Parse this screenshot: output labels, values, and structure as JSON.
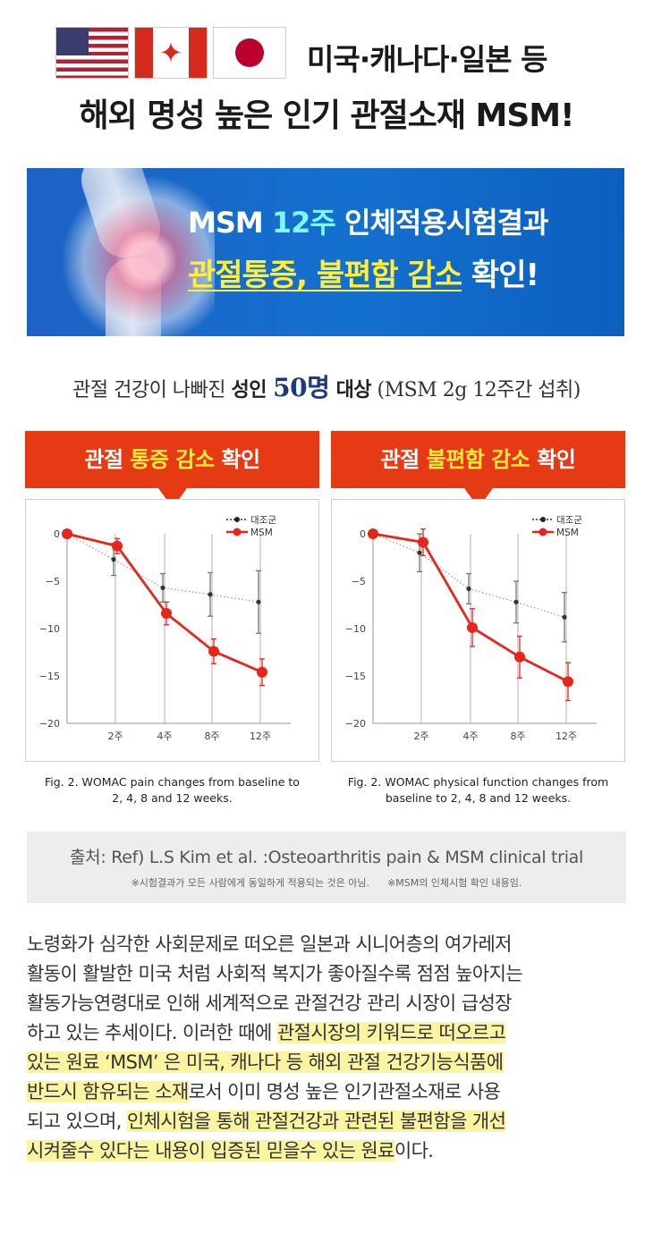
{
  "header": {
    "line1": "미국·캐나다·일본 등",
    "line2": "해외 명성 높은 인기 관절소재 MSM!"
  },
  "banner": {
    "l1_pre": "MSM ",
    "l1_hl": "12주",
    "l1_post": " 인체적용시험결과",
    "l2_hl": "관절통증, 불편함 감소",
    "l2_post": " 확인!"
  },
  "subject": {
    "pre": "관절 건강이 나빠진 ",
    "bold1": "성인 ",
    "num": "50명",
    "bold2": " 대상",
    "post": " (MSM 2g 12주간 섭취)"
  },
  "panels": {
    "left_title_pre": "관절 ",
    "left_title_hl": "통증 감소",
    "left_title_post": " 확인",
    "right_title_pre": "관절 ",
    "right_title_hl": "불편함 감소",
    "right_title_post": " 확인",
    "left_caption_1": "Fig. 2. WOMAC pain changes from baseline to",
    "left_caption_2": "2, 4, 8 and 12 weeks.",
    "right_caption_1": "Fig. 2. WOMAC physical function changes from",
    "right_caption_2": "baseline to 2, 4, 8 and 12 weeks."
  },
  "chart_data": [
    {
      "type": "line",
      "title": "",
      "x": [
        "0",
        "2주",
        "4주",
        "8주",
        "12주"
      ],
      "xticks": [
        "2주",
        "4주",
        "8주",
        "12주"
      ],
      "yticks": [
        "0",
        "−5",
        "−10",
        "−15",
        "−20"
      ],
      "ylim": [
        -20,
        0
      ],
      "grid": "vertical",
      "legend": "top-right",
      "series": [
        {
          "name": "대조군",
          "values": [
            0,
            -2.7,
            -5.7,
            -6.4,
            -7.2
          ],
          "err": [
            0,
            1.7,
            1.5,
            2.3,
            3.3
          ],
          "color": "#333333",
          "style": "dotted"
        },
        {
          "name": "MSM",
          "values": [
            0,
            -1.3,
            -8.4,
            -12.4,
            -14.6
          ],
          "err": [
            0,
            0.8,
            1.2,
            1.3,
            1.4
          ],
          "color": "#e8241b",
          "style": "solid"
        }
      ]
    },
    {
      "type": "line",
      "title": "",
      "x": [
        "0",
        "2주",
        "4주",
        "8주",
        "12주"
      ],
      "xticks": [
        "2주",
        "4주",
        "8주",
        "12주"
      ],
      "yticks": [
        "0",
        "−5",
        "−10",
        "−15",
        "−20"
      ],
      "ylim": [
        -20,
        0
      ],
      "grid": "vertical",
      "legend": "top-right",
      "series": [
        {
          "name": "대조군",
          "values": [
            0,
            -2.0,
            -5.8,
            -7.2,
            -8.8
          ],
          "err": [
            0,
            2.0,
            1.6,
            2.2,
            2.6
          ],
          "color": "#333333",
          "style": "dotted"
        },
        {
          "name": "MSM",
          "values": [
            0,
            -0.9,
            -9.9,
            -13.0,
            -15.6
          ],
          "err": [
            0,
            1.4,
            2.0,
            2.2,
            2.0
          ],
          "color": "#e8241b",
          "style": "solid"
        }
      ]
    }
  ],
  "source": {
    "line1": "출처: Ref) L.S Kim et al. :Osteoarthritis pain & MSM clinical trial",
    "note1": "※시험결과가 모든 사람에게 동일하게 적용되는 것은 아님.",
    "note2": "※MSM의 인체시험 확인 내용임."
  },
  "paragraph": {
    "l1": "노령화가 심각한 사회문제로 떠오른 일본과 시니어층의 여가레저",
    "l2": "활동이 활발한 미국 처럼 사회적 복지가 좋아질수록 점점 높아지는",
    "l3": "활동가능연령대로 인해 세계적으로 관절건강 관리 시장이 급성장",
    "l4_pre": "하고 있는 추세이다. 이러한 때에 ",
    "l4_hl": "관절시장의 키워드로 떠오르고",
    "l5_hl": "있는 원료 ‘MSM’ 은 미국, 캐나다 등 해외 관절 건강기능식품에",
    "l6_hl": "반드시 함유되는 소재",
    "l6_post": "로서 이미 명성 높은 인기관절소재로 사용",
    "l7_pre": "되고 있으며, ",
    "l7_hl": "인체시험을 통해 관절건강과 관련된 불편함을 개선",
    "l8_hl": "시켜줄수 있다는 내용이 입증된 믿을수 있는 원료",
    "l8_post": "이다."
  }
}
